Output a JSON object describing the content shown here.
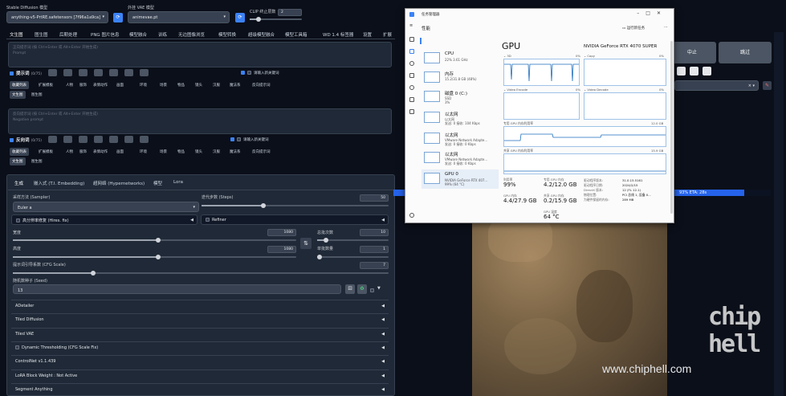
{
  "header": {
    "model_label": "Stable Diffusion 模型",
    "model_value": "anything-v5-PrtRE.safetensors [7f96a1a9ca]",
    "vae_label": "外挂 VAE 模型",
    "vae_value": "animevae.pt",
    "clip_label": "CLIP 终止层数",
    "clip_value": "2",
    "clip_level": 0.17,
    "refresh_icon": "refresh-icon"
  },
  "main_tabs": [
    "文生图",
    "图生图",
    "后期处理",
    "PNG 图片信息",
    "模型融合",
    "训练",
    "无边图像浏览",
    "模型转换",
    "超级模型融合",
    "模型工具箱",
    "WD 1.4 标签器",
    "设置",
    "扩展"
  ],
  "prompt": {
    "placeholder": "正向提示词 (按 Ctrl+Enter 或 Alt+Enter 开始生成)\nPrompt",
    "label": "提示词",
    "count": "(0/75)",
    "addkey": "请输入新关键词",
    "chips": [
      "收藏列表",
      "扩展模板",
      "人物",
      "服饰",
      "表情动作",
      "画面",
      "环境",
      "场景",
      "物品",
      "镜头",
      "汉服",
      "魔法系",
      "反向提示词"
    ],
    "sub_chips": [
      "文生图",
      "图生图"
    ]
  },
  "negative": {
    "placeholder": "反向提示词 (按 Ctrl+Enter 或 Alt+Enter 开始生成)\nNegative prompt",
    "label": "反向词",
    "count": "(0/75)",
    "addkey": "请输入新关键词",
    "chips": [
      "收藏列表",
      "扩展模板",
      "人物",
      "服饰",
      "表情动作",
      "画面",
      "环境",
      "场景",
      "物品",
      "镜头",
      "汉服",
      "魔法系",
      "反向提示词"
    ],
    "sub_chips": [
      "文生图",
      "图生图"
    ]
  },
  "params_tabs": [
    "生成",
    "嵌入式 (T.I. Embedding)",
    "超网络 (Hypernetworks)",
    "模型",
    "Lora"
  ],
  "params": {
    "sampler_label": "采样方法 (Sampler)",
    "sampler_value": "Euler a",
    "steps_label": "迭代步数 (Steps)",
    "steps_value": "50",
    "hires_label": "高分辨率修复 (Hires. fix)",
    "refiner_label": "Refiner",
    "width_label": "宽度",
    "width_value": "1080",
    "height_label": "高度",
    "height_value": "1080",
    "batch_count_label": "总批次数",
    "batch_count_value": "10",
    "batch_size_label": "单批数量",
    "batch_size_value": "1",
    "cfg_label": "提示词引导系数 (CFG Scale)",
    "cfg_value": "7",
    "seed_label": "随机数种子 (Seed)",
    "seed_value": "13"
  },
  "accordions": [
    "ADetailer",
    "Tiled Diffusion",
    "Tiled VAE",
    "Dynamic Thresholding (CFG Scale Fix)",
    "ControlNet v1.1.439",
    "LoRA Block Weight : Not Active",
    "Segment Anything"
  ],
  "right_panel": {
    "interrupt_label": "中止",
    "skip_label": "跳过",
    "progress_text": "93% ETA: 28s",
    "progress_fraction": 0.93,
    "watermark_url": "www.chiphell.com",
    "watermark_logo": "chip hell"
  },
  "task_manager": {
    "title": "任务管理器",
    "section": "性能",
    "run_task": "运行新任务",
    "items": [
      {
        "name": "CPU",
        "sub1": "22%  3.61 GHz",
        "sub2": ""
      },
      {
        "name": "内存",
        "sub1": "15.2/31.8 GB (48%)",
        "sub2": ""
      },
      {
        "name": "磁盘 0 (C:)",
        "sub1": "SSD",
        "sub2": "3%"
      },
      {
        "name": "以太网",
        "sub1": "以太网",
        "sub2": "发送: 0 接收: 104 Kbps"
      },
      {
        "name": "以太网",
        "sub1": "VMware Network Adapte...",
        "sub2": "发送: 0 接收: 0 Kbps"
      },
      {
        "name": "以太网",
        "sub1": "VMware Network Adapte...",
        "sub2": "发送: 0 接收: 0 Kbps"
      },
      {
        "name": "GPU 0",
        "sub1": "NVIDIA GeForce RTX 407...",
        "sub2": "99% (64 °C)"
      }
    ],
    "gpu_title": "GPU",
    "gpu_name": "NVIDIA GeForce RTX 4070 SUPER",
    "graphs": {
      "g3d": "3D",
      "g3d_pct": "0%",
      "copy": "Copy",
      "copy_pct": "0%",
      "encode": "Video Encode",
      "encode_pct": "0%",
      "decode": "Video Decode",
      "decode_pct": "0%",
      "dedicated": "专用 GPU 内存利用率",
      "dedicated_max": "12.0 GB",
      "shared": "共享 GPU 内存利用率",
      "shared_max": "15.9 GB"
    },
    "stats": [
      {
        "label": "利用率",
        "value": "99%"
      },
      {
        "label": "专用 GPU 内存",
        "value": "4.2/12.0 GB"
      },
      {
        "label": "GPU 内存",
        "value": "4.4/27.9 GB"
      },
      {
        "label": "共享 GPU 内存",
        "value": "0.2/15.9 GB"
      },
      {
        "label": "GPU 温度",
        "value": "64 °C"
      }
    ],
    "info": [
      {
        "label": "驱动程序版本:",
        "value": "31.0.15.5161"
      },
      {
        "label": "驱动程序日期:",
        "value": "2024/2/15"
      },
      {
        "label": "DirectX 版本:",
        "value": "12 (FL 12.1)"
      },
      {
        "label": "物理位置:",
        "value": "PCI 总线 1, 设备 0..."
      },
      {
        "label": "为硬件保留的内存:",
        "value": "289 MB"
      }
    ]
  }
}
